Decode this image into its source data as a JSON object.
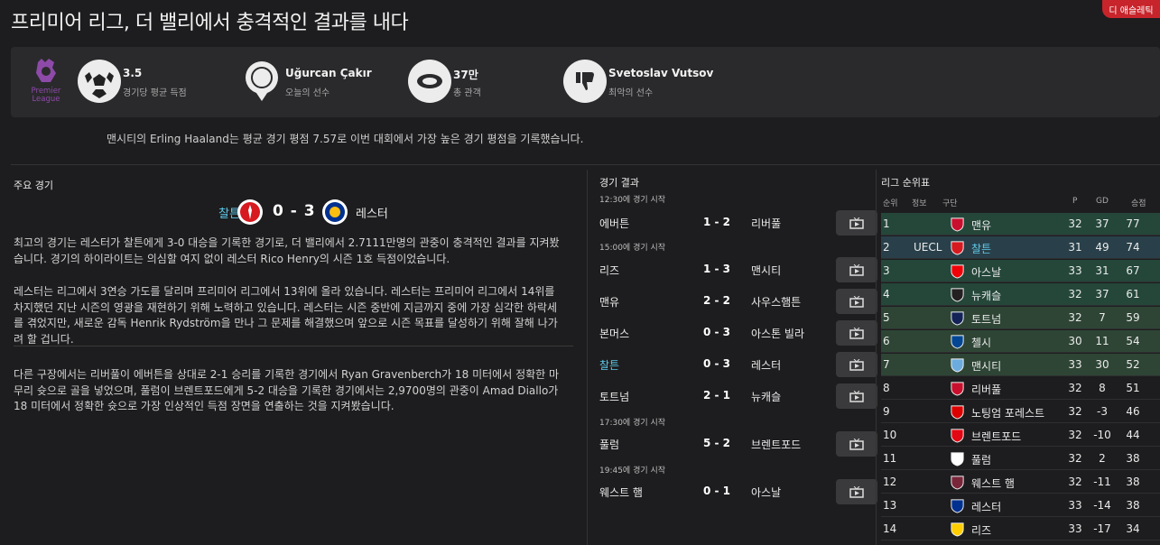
{
  "header": {
    "title": "프리미어 리그, 더 밸리에서 충격적인 결과를 내다",
    "corner_badge": "디 애슬레틱"
  },
  "stats": {
    "logo_text": "Premier League",
    "items": [
      {
        "icon": "soccer-ball-icon",
        "value": "3.5",
        "label": "경기당 평균 득점"
      },
      {
        "icon": "medal-icon",
        "value": "Uğurcan Çakır",
        "label": "오늘의 선수"
      },
      {
        "icon": "stadium-icon",
        "value": "37만",
        "label": "총 관객"
      },
      {
        "icon": "thumbs-down-icon",
        "value": "Svetoslav Vutsov",
        "label": "최악의 선수"
      }
    ],
    "summary": "맨시티의 Erling Haaland는 평균 경기 평점 7.57로 이번 대회에서 가장 높은 경기 평점을 기록했습니다."
  },
  "featured": {
    "title": "주요 경기",
    "home": "찰튼",
    "score": "0 - 3",
    "away": "레스터",
    "paragraphs": [
      "최고의 경기는 레스터가 찰튼에게 3-0 대승을 기록한 경기로, 더 밸리에서 2.7111만명의 관중이 충격적인 결과를 지켜봤습니다. 경기의 하이라이트는 의심할 여지 없이 레스터 Rico Henry의 시즌 1호 득점이었습니다.",
      "레스터는 리그에서 3연승 가도를 달리며 프리미어 리그에서 13위에 올라 있습니다. 레스터는 프리미어 리그에서 14위를 차지했던 지난 시즌의 영광을 재현하기 위해 노력하고 있습니다. 레스터는 시즌 중반에 지금까지 중에 가장 심각한 하락세를 겪었지만, 새로운 감독 Henrik Rydström을 만나 그 문제를 해결했으며 앞으로 시즌 목표를 달성하기 위해 잘해 나가려 할 겁니다.",
      "다른 구장에서는 리버풀이 에버튼을 상대로 2-1 승리를 기록한 경기에서 Ryan Gravenberch가 18 미터에서 정확한 마무리 슛으로 골을 넣었으며, 풀럼이 브렌트포드에게 5-2 대승을 기록한 경기에서는 2,9700명의 관중이 Amad Diallo가 18 미터에서 정확한 슛으로 가장 인상적인 득점 장면을 연출하는 것을 지켜봤습니다."
    ]
  },
  "results": {
    "title": "경기 결과",
    "kickoffs": [
      "12:30에 경기 시작",
      "15:00에 경기 시작",
      "17:30에 경기 시작",
      "19:45에 경기 시작"
    ],
    "matches": [
      {
        "home": "에버튼",
        "score": "1 - 2",
        "away": "리버풀"
      },
      {
        "home": "리즈",
        "score": "1 - 3",
        "away": "맨시티"
      },
      {
        "home": "맨유",
        "score": "2 - 2",
        "away": "사우스햄튼"
      },
      {
        "home": "본머스",
        "score": "0 - 3",
        "away": "아스톤 빌라"
      },
      {
        "home": "찰튼",
        "score": "0 - 3",
        "away": "레스터"
      },
      {
        "home": "토트넘",
        "score": "2 - 1",
        "away": "뉴캐슬"
      },
      {
        "home": "풀럼",
        "score": "5 - 2",
        "away": "브렌트포드"
      },
      {
        "home": "웨스트 햄",
        "score": "0 - 1",
        "away": "아스날"
      }
    ]
  },
  "table": {
    "title": "리그 순위표",
    "headers": {
      "pos": "순위",
      "info": "정보",
      "team": "구단",
      "p": "P",
      "gd": "GD",
      "pts": "승점"
    },
    "rows": [
      {
        "pos": "1",
        "info": "",
        "team": "맨유",
        "p": "32",
        "gd": "37",
        "pts": "77",
        "color": "#c8102e"
      },
      {
        "pos": "2",
        "info": "UECL",
        "team": "찰튼",
        "p": "31",
        "gd": "49",
        "pts": "74",
        "color": "#d71920"
      },
      {
        "pos": "3",
        "info": "",
        "team": "아스날",
        "p": "33",
        "gd": "31",
        "pts": "67",
        "color": "#ef0107"
      },
      {
        "pos": "4",
        "info": "",
        "team": "뉴캐슬",
        "p": "32",
        "gd": "37",
        "pts": "61",
        "color": "#241f20"
      },
      {
        "pos": "5",
        "info": "",
        "team": "토트넘",
        "p": "32",
        "gd": "7",
        "pts": "59",
        "color": "#132257"
      },
      {
        "pos": "6",
        "info": "",
        "team": "첼시",
        "p": "30",
        "gd": "11",
        "pts": "54",
        "color": "#034694"
      },
      {
        "pos": "7",
        "info": "",
        "team": "맨시티",
        "p": "33",
        "gd": "30",
        "pts": "52",
        "color": "#6cabdd"
      },
      {
        "pos": "8",
        "info": "",
        "team": "리버풀",
        "p": "32",
        "gd": "8",
        "pts": "51",
        "color": "#c8102e"
      },
      {
        "pos": "9",
        "info": "",
        "team": "노팅엄 포레스트",
        "p": "32",
        "gd": "-3",
        "pts": "46",
        "color": "#dd0000"
      },
      {
        "pos": "10",
        "info": "",
        "team": "브렌트포드",
        "p": "32",
        "gd": "-10",
        "pts": "44",
        "color": "#e30613"
      },
      {
        "pos": "11",
        "info": "",
        "team": "풀럼",
        "p": "32",
        "gd": "2",
        "pts": "38",
        "color": "#ffffff"
      },
      {
        "pos": "12",
        "info": "",
        "team": "웨스트 햄",
        "p": "32",
        "gd": "-11",
        "pts": "38",
        "color": "#7a263a"
      },
      {
        "pos": "13",
        "info": "",
        "team": "레스터",
        "p": "33",
        "gd": "-14",
        "pts": "38",
        "color": "#003090"
      },
      {
        "pos": "14",
        "info": "",
        "team": "리즈",
        "p": "33",
        "gd": "-17",
        "pts": "34",
        "color": "#ffcd00"
      }
    ]
  }
}
